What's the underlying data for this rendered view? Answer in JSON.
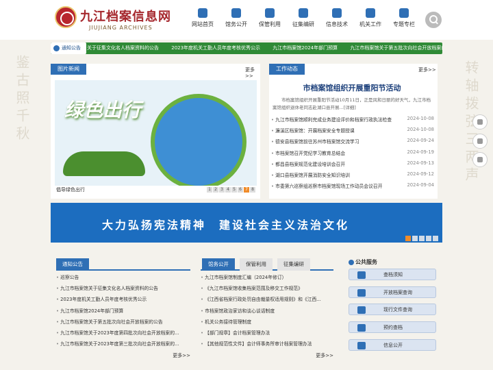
{
  "header": {
    "brand": "九江档案信息网",
    "brand_en": "JIUJIANG ARCHIVES"
  },
  "nav": [
    "网站首页",
    "馆务公开",
    "保管利用",
    "征集编研",
    "信息技术",
    "机关工作",
    "专题专栏"
  ],
  "ticker": {
    "label": "通知公告",
    "items": [
      "关于征集文化名人档案资料的公告",
      "2023年度机关工勤人员年度考核优秀公示",
      "九江市档案馆2024年部门预算",
      "九江市档案馆关于第五批次向社会开放档案的公告"
    ]
  },
  "photos": {
    "title": "图片新闻",
    "more": "更多>>",
    "caption": "倡导绿色出行",
    "slogan": "绿色出行",
    "pages": [
      "1",
      "2",
      "3",
      "4",
      "5",
      "6",
      "7",
      "8"
    ],
    "active_page": 7
  },
  "work": {
    "title": "工作动态",
    "more": "更多>>",
    "headline": "市档案馆组织开展重阳节活动",
    "summary": "市档案馆组织开展重阳节活动10月11日，正是风和日丽的好天气，九江市档案馆组织退休老同志赴湖口县开展...[详细]",
    "items": [
      {
        "t": "九江市档案馆顺利完成业务建设评价和档案行政执法检查",
        "d": "2024-10-08"
      },
      {
        "t": "濂溪区档案馆：开展档案安全专题授课",
        "d": "2024-10-08"
      },
      {
        "t": "德安县档案馆前往苏州市档案馆交流学习",
        "d": "2024-09-24"
      },
      {
        "t": "市档案馆召开党纪学习教育总结会",
        "d": "2024-09-19"
      },
      {
        "t": "都昌县档案规范化建设培训会召开",
        "d": "2024-09-13"
      },
      {
        "t": "湖口县档案馆开展消防安全知识培训",
        "d": "2024-09-12"
      },
      {
        "t": "市委第六巡察组巡察市档案馆现场工作动员会议召开",
        "d": "2024-09-04"
      }
    ]
  },
  "banner": {
    "text": "大力弘扬宪法精神　建设社会主义法治文化"
  },
  "notices": {
    "title": "通知公告",
    "items": [
      "巡察公告",
      "九江市档案馆关于征集文化名人档案资料的公告",
      "2023年度机关工勤人员年度考核优秀公示",
      "九江市档案馆2024年部门预算",
      "九江市档案馆关于第五批次向社会开放档案的公告",
      "九江市档案馆关于2023年度第四批次向社会开放档案的...",
      "九江市档案馆关于2023年度第三批次向社会开放档案的..."
    ],
    "more": "更多>>"
  },
  "tabs": {
    "labels": [
      "馆务公开",
      "保管利用",
      "征集编研"
    ],
    "items": [
      "九江市档案馆制度汇编（2024年修订）",
      "《九江市档案馆收集档案范围及移交工作规范》",
      "《江西省档案行政处罚自由裁量权适用规则》和《江西...",
      "市档案馆政治家访和谈心谈话制度",
      "机关公务接待管理制度",
      "【部门规章】会计档案管理办法",
      "【其他规范性文件】会计师事务所审计档案管理办法"
    ],
    "more": "更多>>"
  },
  "services": {
    "title": "公共服务",
    "items": [
      "查档须知",
      "开放档案查询",
      "现行文件查询",
      "预约查档",
      "信息公开"
    ]
  },
  "calligraphy": {
    "left": "鉴古照千秋",
    "right": "转轴拨弦三两声"
  }
}
